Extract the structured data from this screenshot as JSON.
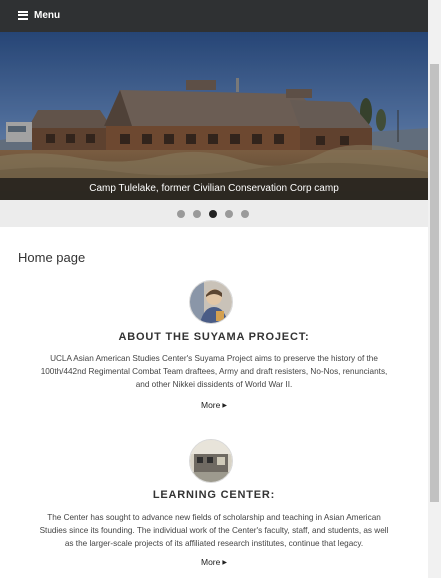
{
  "header": {
    "menu_label": "Menu",
    "menu_icon": "hamburger-icon"
  },
  "slider": {
    "caption": "Camp Tulelake, former Civilian Conservation Corp camp",
    "dot_count": 5,
    "active_dot": 3
  },
  "main": {
    "page_title": "Home page",
    "sections": [
      {
        "title": "ABOUT THE SUYAMA PROJECT:",
        "text_lines": [
          "UCLA Asian American Studies Center's Suyama Project aims to preserve the history of the",
          "100th/442nd Regimental Combat Team draftees, Army and draft resisters, No-Nos, renunciants,",
          "and other Nikkei dissidents of World War II."
        ],
        "more_label": "More"
      },
      {
        "title": "LEARNING CENTER:",
        "text_lines": [
          "The Center has sought to advance new fields of scholarship and teaching in Asian American",
          "Studies since its founding. The individual work of the Center's faculty, staff, and students, as well",
          "as the larger-scale projects of its affiliated research institutes, continue that legacy."
        ],
        "more_label": "More"
      }
    ]
  },
  "colors": {
    "topbar": "#2f3133",
    "dots_background": "#ececec",
    "dot_inactive": "#9a9a9a",
    "dot_active": "#222222"
  }
}
